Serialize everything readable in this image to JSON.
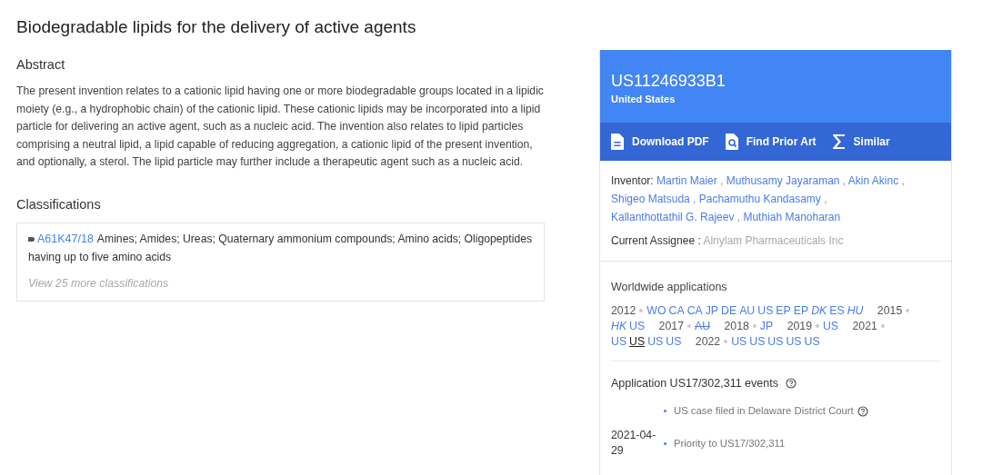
{
  "title": "Biodegradable lipids for the delivery of active agents",
  "abstract": {
    "heading": "Abstract",
    "text": "The present invention relates to a cationic lipid having one or more biodegradable groups located in a lipidic moiety (e.g., a hydrophobic chain) of the cationic lipid. These cationic lipids may be incorporated into a lipid particle for delivering an active agent, such as a nucleic acid. The invention also relates to lipid particles comprising a neutral lipid, a lipid capable of reducing aggregation, a cationic lipid of the present invention, and optionally, a sterol. The lipid particle may further include a therapeutic agent such as a nucleic acid."
  },
  "classifications": {
    "heading": "Classifications",
    "items": [
      {
        "code": "A61K47/18",
        "description": "Amines; Amides; Ureas; Quaternary ammonium compounds; Amino acids; Oligopeptides having up to five amino acids"
      }
    ],
    "more": "View 25 more classifications"
  },
  "patent": {
    "number": "US11246933B1",
    "country": "United States",
    "actions": [
      {
        "kind": "pdf",
        "label": "Download PDF"
      },
      {
        "kind": "prior-art",
        "label": "Find Prior Art"
      },
      {
        "kind": "similar",
        "label": "Similar"
      }
    ],
    "inventor_label": "Inventor:",
    "inventor_separator": ",",
    "inventors": [
      "Martin Maier",
      "Muthusamy Jayaraman",
      "Akin Akinc",
      "Shigeo Matsuda",
      "Pachamuthu Kandasamy",
      "Kallanthottathil G. Rajeev",
      "Muthiah Manoharan"
    ],
    "assignee_label": "Current Assignee :",
    "assignee": "Alnylam Pharmaceuticals Inc"
  },
  "worldwide": {
    "heading": "Worldwide applications",
    "years": [
      {
        "year": "2012",
        "apps": [
          {
            "code": "WO",
            "kind": "normal"
          },
          {
            "code": "CA",
            "kind": "normal"
          },
          {
            "code": "CA",
            "kind": "normal"
          },
          {
            "code": "JP",
            "kind": "normal"
          },
          {
            "code": "DE",
            "kind": "normal"
          },
          {
            "code": "AU",
            "kind": "normal"
          },
          {
            "code": "US",
            "kind": "normal"
          },
          {
            "code": "EP",
            "kind": "normal"
          },
          {
            "code": "EP",
            "kind": "normal"
          },
          {
            "code": "DK",
            "kind": "italic"
          },
          {
            "code": "ES",
            "kind": "normal"
          },
          {
            "code": "HU",
            "kind": "italic"
          }
        ]
      },
      {
        "year": "2015",
        "apps": [
          {
            "code": "HK",
            "kind": "italic"
          },
          {
            "code": "US",
            "kind": "normal"
          }
        ]
      },
      {
        "year": "2017",
        "apps": [
          {
            "code": "AU",
            "kind": "withdrawn"
          }
        ]
      },
      {
        "year": "2018",
        "apps": [
          {
            "code": "JP",
            "kind": "normal"
          }
        ]
      },
      {
        "year": "2019",
        "apps": [
          {
            "code": "US",
            "kind": "normal"
          }
        ]
      },
      {
        "year": "2021",
        "apps": [
          {
            "code": "US",
            "kind": "normal"
          },
          {
            "code": "US",
            "kind": "current"
          },
          {
            "code": "US",
            "kind": "normal"
          },
          {
            "code": "US",
            "kind": "normal"
          }
        ]
      },
      {
        "year": "2022",
        "apps": [
          {
            "code": "US",
            "kind": "normal"
          },
          {
            "code": "US",
            "kind": "normal"
          },
          {
            "code": "US",
            "kind": "normal"
          },
          {
            "code": "US",
            "kind": "normal"
          },
          {
            "code": "US",
            "kind": "normal"
          }
        ]
      }
    ]
  },
  "events": {
    "heading": "Application US17/302,311 events",
    "items": [
      {
        "text": "US case filed in Delaware District Court",
        "help": true
      },
      {
        "date": "2021-04-29",
        "text": "Priority to US17/302,311",
        "help": false
      }
    ]
  }
}
